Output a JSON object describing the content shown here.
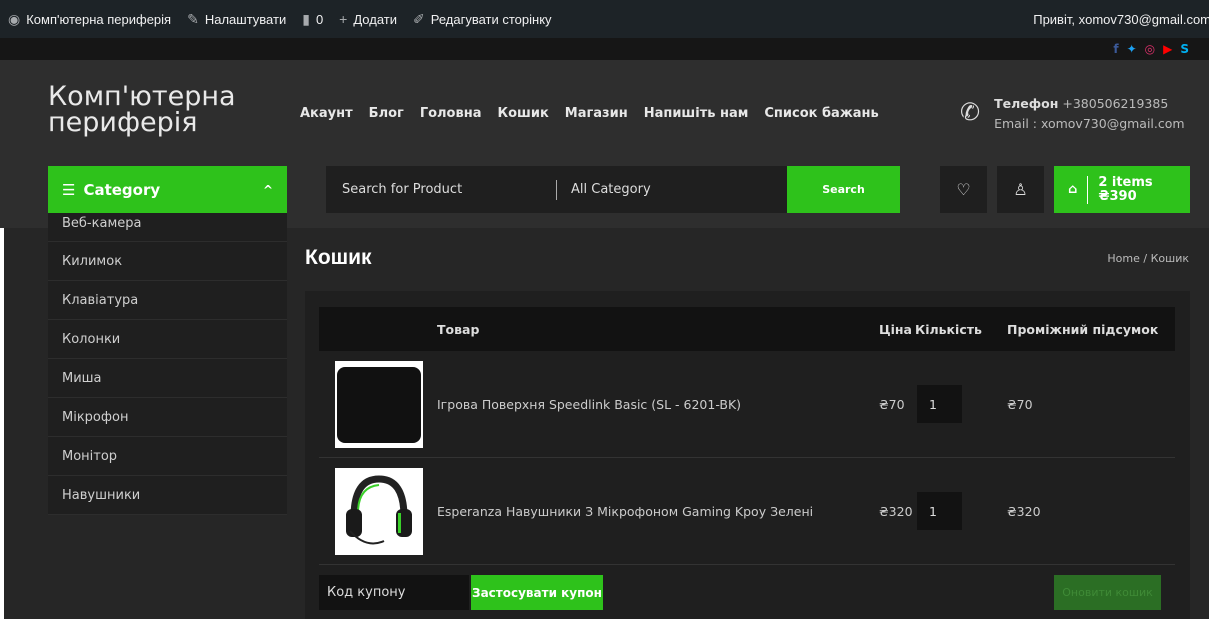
{
  "adminbar": {
    "site_name": "Комп'ютерна периферія",
    "customize": "Налаштувати",
    "comments_count": "0",
    "add_new": "Додати",
    "edit_page": "Редагувати сторінку",
    "greeting": "Привіт, xomov730@gmail.com"
  },
  "social": {
    "facebook": "f",
    "twitter": "✦",
    "instagram": "◎",
    "youtube": "▶",
    "skype": "S"
  },
  "header": {
    "logo": "Комп'ютерна периферія",
    "nav": [
      "Акаунт",
      "Блог",
      "Головна",
      "Кошик",
      "Магазин",
      "Напишіть нам",
      "Список бажань"
    ],
    "phone_label": "Телефон",
    "phone": "+380506219385",
    "email_line": "Email : xomov730@gmail.com"
  },
  "category": {
    "button_label": "Category",
    "items": [
      "Веб-камера",
      "Килимок",
      "Клавіатура",
      "Колонки",
      "Миша",
      "Мікрофон",
      "Монітор",
      "Навушники"
    ]
  },
  "search": {
    "placeholder": "Search for Product",
    "category": "All Category",
    "button": "Search"
  },
  "mini_cart": {
    "items": "2 items",
    "total": "₴390"
  },
  "page": {
    "title": "Кошик",
    "breadcrumb": "Home /  Кошик"
  },
  "cart": {
    "headers": {
      "product": "Товар",
      "price": "Ціна",
      "quantity": "Кількість",
      "subtotal": "Проміжний підсумок"
    },
    "rows": [
      {
        "name": "Ігрова Поверхня Speedlink Basic (SL - 6201-BK)",
        "price": "₴70",
        "qty": "1",
        "subtotal": "₴70"
      },
      {
        "name": "Esperanza Навушники З Мікрофоном Gaming Kpoy Зелені",
        "price": "₴320",
        "qty": "1",
        "subtotal": "₴320"
      }
    ],
    "coupon_placeholder": "Код купону",
    "apply_coupon": "Застосувати купон",
    "update_cart": "Оновити кошик"
  },
  "colors": {
    "accent": "#2ec21b",
    "bg": "#262626",
    "panel": "#1f1f1f"
  }
}
